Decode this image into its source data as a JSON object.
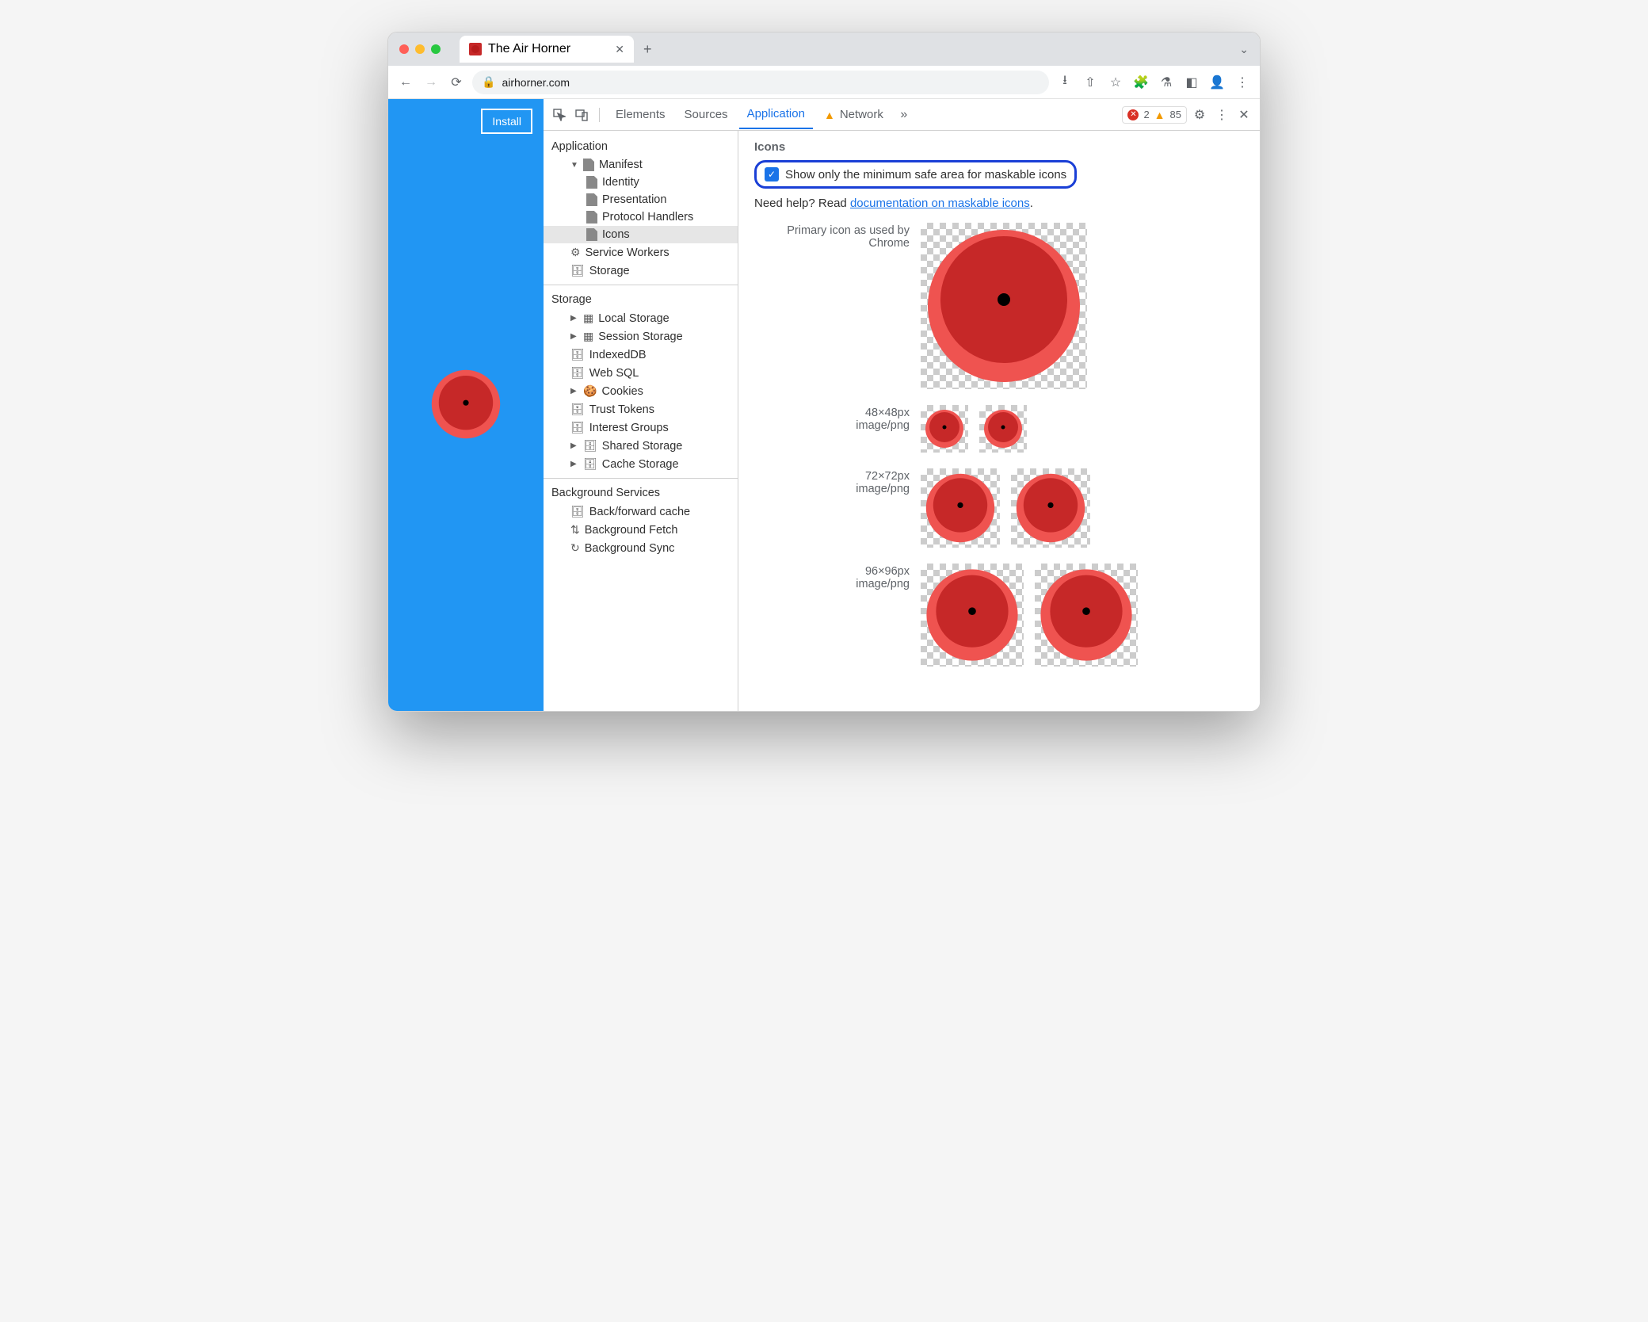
{
  "browser": {
    "tab_title": "The Air Horner",
    "url_host": "airhorner.com",
    "install_button": "Install"
  },
  "devtools": {
    "tabs": [
      "Elements",
      "Sources",
      "Application",
      "Network"
    ],
    "active_tab": "Application",
    "errors": "2",
    "warnings": "85"
  },
  "sidebar": {
    "application": {
      "title": "Application",
      "manifest": "Manifest",
      "identity": "Identity",
      "presentation": "Presentation",
      "protocol_handlers": "Protocol Handlers",
      "icons": "Icons",
      "service_workers": "Service Workers",
      "storage": "Storage"
    },
    "storage": {
      "title": "Storage",
      "local": "Local Storage",
      "session": "Session Storage",
      "indexed": "IndexedDB",
      "websql": "Web SQL",
      "cookies": "Cookies",
      "trust": "Trust Tokens",
      "interest": "Interest Groups",
      "shared": "Shared Storage",
      "cache": "Cache Storage"
    },
    "background": {
      "title": "Background Services",
      "bfcache": "Back/forward cache",
      "fetch": "Background Fetch",
      "sync": "Background Sync"
    }
  },
  "main": {
    "heading": "Icons",
    "checkbox_label": "Show only the minimum safe area for maskable icons",
    "help_prefix": "Need help? Read ",
    "help_link": "documentation on maskable icons",
    "rows": {
      "primary_l1": "Primary icon as used by",
      "primary_l2": "Chrome",
      "r48_size": "48×48px",
      "r48_type": "image/png",
      "r72_size": "72×72px",
      "r72_type": "image/png",
      "r96_size": "96×96px",
      "r96_type": "image/png"
    }
  }
}
